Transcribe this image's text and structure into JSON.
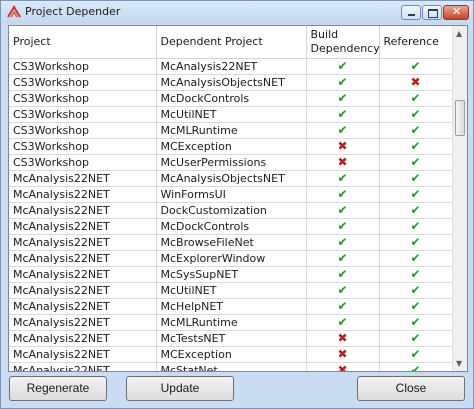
{
  "window": {
    "title": "Project Depender"
  },
  "columns": [
    "Project",
    "Dependent Project",
    "Build\nDependency",
    "Reference"
  ],
  "rows": [
    [
      "CS3Workshop",
      "McAnalysis22NET",
      "yes",
      "yes"
    ],
    [
      "CS3Workshop",
      "McAnalysisObjectsNET",
      "yes",
      "no"
    ],
    [
      "CS3Workshop",
      "McDockControls",
      "yes",
      "yes"
    ],
    [
      "CS3Workshop",
      "McUtilNET",
      "yes",
      "yes"
    ],
    [
      "CS3Workshop",
      "McMLRuntime",
      "yes",
      "yes"
    ],
    [
      "CS3Workshop",
      "MCException",
      "no",
      "yes"
    ],
    [
      "CS3Workshop",
      "McUserPermissions",
      "no",
      "yes"
    ],
    [
      "McAnalysis22NET",
      "McAnalysisObjectsNET",
      "yes",
      "yes"
    ],
    [
      "McAnalysis22NET",
      "WinFormsUI",
      "yes",
      "yes"
    ],
    [
      "McAnalysis22NET",
      "DockCustomization",
      "yes",
      "yes"
    ],
    [
      "McAnalysis22NET",
      "McDockControls",
      "yes",
      "yes"
    ],
    [
      "McAnalysis22NET",
      "McBrowseFileNet",
      "yes",
      "yes"
    ],
    [
      "McAnalysis22NET",
      "McExplorerWindow",
      "yes",
      "yes"
    ],
    [
      "McAnalysis22NET",
      "McSysSupNET",
      "yes",
      "yes"
    ],
    [
      "McAnalysis22NET",
      "McUtilNET",
      "yes",
      "yes"
    ],
    [
      "McAnalysis22NET",
      "McHelpNET",
      "yes",
      "yes"
    ],
    [
      "McAnalysis22NET",
      "McMLRuntime",
      "yes",
      "yes"
    ],
    [
      "McAnalysis22NET",
      "McTestsNET",
      "no",
      "yes"
    ],
    [
      "McAnalysis22NET",
      "MCException",
      "no",
      "yes"
    ],
    [
      "McAnalysis22NET",
      "McStatNet",
      "no",
      "yes"
    ]
  ],
  "buttons": {
    "regenerate": "Regenerate",
    "update": "Update",
    "close": "Close"
  },
  "glyphs": {
    "yes": "✔",
    "no": "✖"
  },
  "colors": {
    "check": "#1e9a1e",
    "cross": "#b41f1f"
  }
}
